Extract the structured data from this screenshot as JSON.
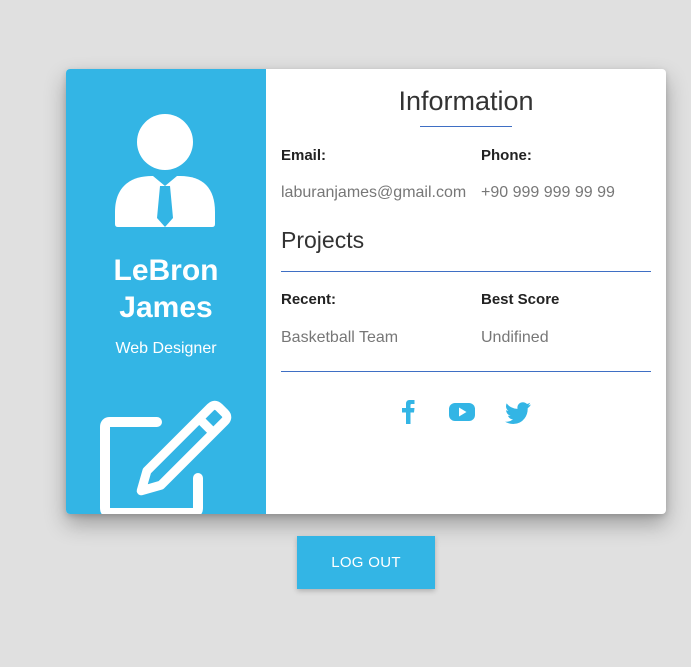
{
  "profile": {
    "first_name": "LeBron",
    "last_name": "James",
    "role": "Web Designer",
    "accent_color": "#33b5e5"
  },
  "information": {
    "title": "Information",
    "email_label": "Email:",
    "email_value": "laburanjames@gmail.com",
    "phone_label": "Phone:",
    "phone_value": "+90 999 999 99 99"
  },
  "projects": {
    "title": "Projects",
    "recent_label": "Recent:",
    "recent_value": "Basketball Team",
    "best_score_label": "Best Score",
    "best_score_value": "Undifined"
  },
  "social": [
    {
      "icon": "facebook-icon"
    },
    {
      "icon": "youtube-icon"
    },
    {
      "icon": "twitter-icon"
    }
  ],
  "actions": {
    "logout_label": "LOG OUT",
    "edit_icon": "edit-icon"
  }
}
